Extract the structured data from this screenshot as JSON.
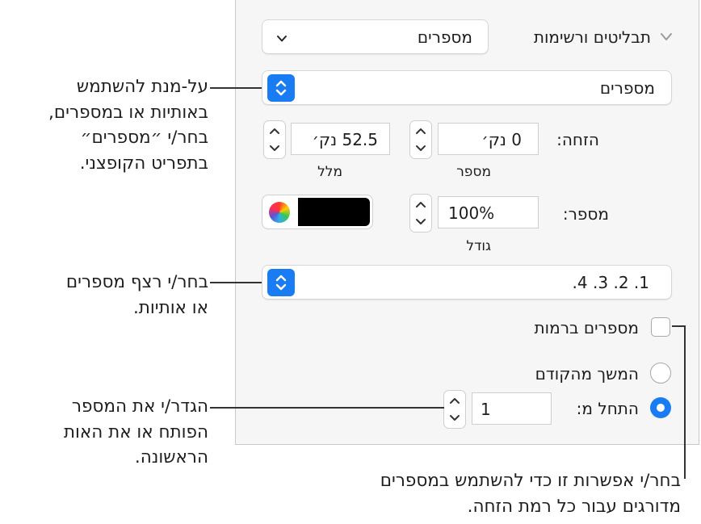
{
  "panel": {
    "section_title": "תבליטים ורשימות",
    "style_popup_value": "מספרים",
    "type_popup_value": "מספרים",
    "indent_label": "הזחה:",
    "number_indent_value": "0 נק׳",
    "number_indent_caption": "מספר",
    "text_indent_value": "52.5 נק׳",
    "text_indent_caption": "מלל",
    "number_size_label": "מספר:",
    "number_size_value": "100%",
    "number_size_caption": "גודל",
    "number_color": "#000000",
    "sequence_value": "1. 2. 3. 4.",
    "tiered_numbers_label": "מספרים ברמות",
    "tiered_numbers_checked": false,
    "continue_label": "המשך מהקודם",
    "start_at_label": "התחל מ:",
    "start_at_value": "1",
    "accent_color": "#1a7cf3"
  },
  "callouts": {
    "type_popup": [
      "על-מנת להשתמש",
      "באותיות או במספרים,",
      "בחר/י ״מספרים״",
      "בתפריט הקופצני."
    ],
    "sequence": [
      "בחר/י רצף מספרים",
      "או אותיות."
    ],
    "start_at": [
      "הגדר/י את המספר",
      "הפותח או את האות",
      "הראשונה."
    ],
    "tiered": [
      "בחר/י אפשרות זו כדי להשתמש במספרים",
      "מדורגים עבור כל רמת הזחה."
    ]
  }
}
